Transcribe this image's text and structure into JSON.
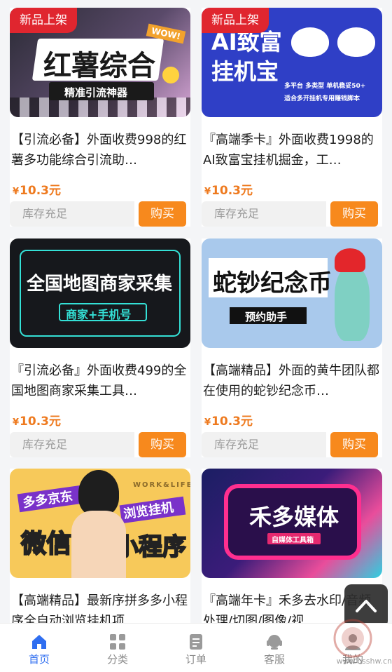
{
  "products": [
    {
      "badge": "新品上架",
      "thumb_line1": "红薯综合",
      "thumb_line2": "精准引流神器",
      "thumb_tag": "WOW!",
      "title": "【引流必备】外面收费998的红薯多功能综合引流助…",
      "currency": "¥",
      "price": "10.3元",
      "stock": "库存充足",
      "buy": "购买"
    },
    {
      "badge": "新品上架",
      "thumb_line1": "AI致富",
      "thumb_line2": "挂机宝",
      "thumb_sub1": "多平台 多类型 单机稳妥50+",
      "thumb_sub2": "适合多开挂机专用赚钱脚本",
      "title": "『高端季卡』外面收费1998的AI致富宝挂机掘金，工…",
      "currency": "¥",
      "price": "10.3元",
      "stock": "库存充足",
      "buy": "购买"
    },
    {
      "thumb_line1": "全国地图商家采集",
      "thumb_line2": "商家+手机号",
      "title": "『引流必备』外面收费499的全国地图商家采集工具…",
      "currency": "¥",
      "price": "10.3元",
      "stock": "库存充足",
      "buy": "购买"
    },
    {
      "thumb_line1": "蛇钞纪念币",
      "thumb_line2": "预约助手",
      "title": "【高端精品】外面的黄牛团队都在使用的蛇钞纪念币…",
      "currency": "¥",
      "price": "10.3元",
      "stock": "库存充足",
      "buy": "购买"
    },
    {
      "thumb_line1": "多多京东",
      "thumb_line2": "浏览挂机",
      "thumb_line3": "微信",
      "thumb_line4": "小程序",
      "thumb_tag": "WORK&LIFE",
      "title": "【高端精品】最新序拼多多小程序全自动浏览挂机项…"
    },
    {
      "thumb_line1": "禾多媒体",
      "thumb_line2": "自媒体工具箱",
      "title": "『高端年卡』禾多去水印/音频处理/切图/图像/视…"
    }
  ],
  "tabbar": [
    {
      "label": "首页",
      "icon": "home-icon",
      "active": true
    },
    {
      "label": "分类",
      "icon": "grid-icon",
      "active": false
    },
    {
      "label": "订单",
      "icon": "order-icon",
      "active": false
    },
    {
      "label": "客服",
      "icon": "headset-icon",
      "active": false
    },
    {
      "label": "我的",
      "icon": "user-icon",
      "active": false
    }
  ],
  "watermark": "www.bsshw.cn",
  "colors": {
    "accent": "#f7891d",
    "price": "#ee7a1f",
    "badge": "#e0262f",
    "tab_active": "#2f6ef0"
  }
}
